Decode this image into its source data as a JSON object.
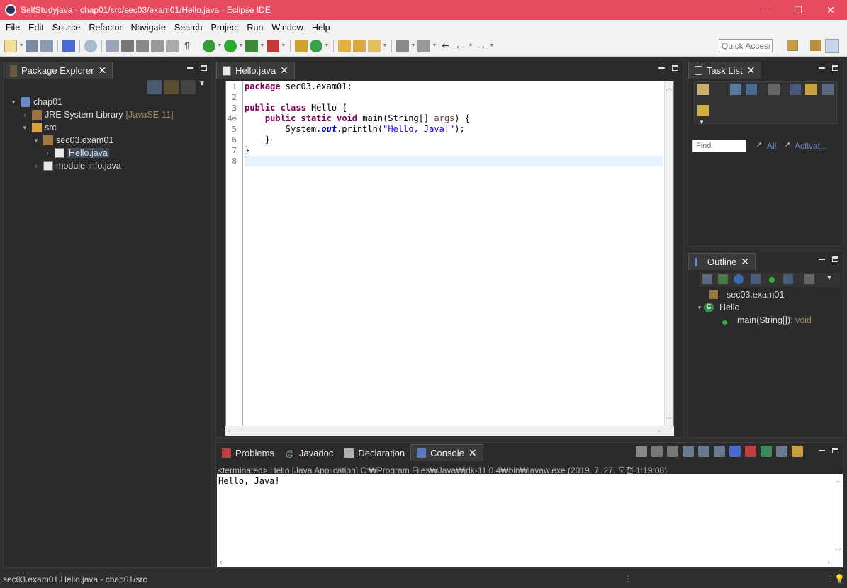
{
  "window": {
    "title": "SelfStudyjava - chap01/src/sec03/exam01/Hello.java - Eclipse IDE",
    "minimize": "—",
    "maximize": "☐",
    "close": "✕"
  },
  "menu": [
    "File",
    "Edit",
    "Source",
    "Refactor",
    "Navigate",
    "Search",
    "Project",
    "Run",
    "Window",
    "Help"
  ],
  "toolbar": {
    "quick_access_placeholder": "Quick Access"
  },
  "package_explorer": {
    "tab_label": "Package Explorer",
    "tree": [
      {
        "label": "chap01",
        "deco": "",
        "indent": 0,
        "twisty": "▾",
        "icon": "project-icon"
      },
      {
        "label": "JRE System Library",
        "deco": "[JavaSE-11]",
        "indent": 1,
        "twisty": "›",
        "icon": "library-icon"
      },
      {
        "label": "src",
        "deco": "",
        "indent": 1,
        "twisty": "▾",
        "icon": "folder-icon"
      },
      {
        "label": "sec03.exam01",
        "deco": "",
        "indent": 2,
        "twisty": "▾",
        "icon": "package-icon"
      },
      {
        "label": "Hello.java",
        "deco": "",
        "indent": 3,
        "twisty": "›",
        "icon": "java-file-icon"
      },
      {
        "label": "module-info.java",
        "deco": "",
        "indent": 2,
        "twisty": "›",
        "icon": "java-file-icon"
      }
    ]
  },
  "editor": {
    "tab_label": "Hello.java",
    "line_numbers": [
      "1",
      "2",
      "3",
      "4⊖",
      "5",
      "6",
      "7",
      "8"
    ],
    "lines": [
      [
        {
          "t": "kw",
          "v": "package"
        },
        {
          "t": "",
          "v": " sec03.exam01;"
        }
      ],
      [],
      [
        {
          "t": "kw",
          "v": "public"
        },
        {
          "t": "",
          "v": " "
        },
        {
          "t": "kw",
          "v": "class"
        },
        {
          "t": "",
          "v": " Hello {"
        }
      ],
      [
        {
          "t": "",
          "v": "    "
        },
        {
          "t": "kw",
          "v": "public"
        },
        {
          "t": "",
          "v": " "
        },
        {
          "t": "kw",
          "v": "static"
        },
        {
          "t": "",
          "v": " "
        },
        {
          "t": "kw",
          "v": "void"
        },
        {
          "t": "",
          "v": " main(String[] "
        },
        {
          "t": "par",
          "v": "args"
        },
        {
          "t": "",
          "v": ") {"
        }
      ],
      [
        {
          "t": "",
          "v": "        System."
        },
        {
          "t": "fld",
          "v": "out"
        },
        {
          "t": "",
          "v": ".println("
        },
        {
          "t": "str",
          "v": "\"Hello, Java!\""
        },
        {
          "t": "",
          "v": ");"
        }
      ],
      [
        {
          "t": "",
          "v": "    }"
        }
      ],
      [
        {
          "t": "",
          "v": "}"
        }
      ],
      []
    ],
    "current_line": 8
  },
  "task_list": {
    "tab_label": "Task List",
    "find_placeholder": "Find",
    "filter_all": "All",
    "filter_activate": "Activat..."
  },
  "outline": {
    "tab_label": "Outline",
    "items": [
      {
        "label": "sec03.exam01",
        "detail": "",
        "indent": 0,
        "icon": "package-icon"
      },
      {
        "label": "Hello",
        "detail": "",
        "indent": 0,
        "icon": "class-icon"
      },
      {
        "label": "main(String[])",
        "detail": " : void",
        "indent": 1,
        "icon": "method-icon"
      }
    ]
  },
  "bottom_tabs": [
    {
      "label": "Problems",
      "icon": "problems-icon",
      "active": false
    },
    {
      "label": "Javadoc",
      "icon": "javadoc-icon",
      "active": false
    },
    {
      "label": "Declaration",
      "icon": "declaration-icon",
      "active": false
    },
    {
      "label": "Console",
      "icon": "console-icon",
      "active": true
    }
  ],
  "console": {
    "status": "<terminated> Hello [Java Application] C:₩Program Files₩Java₩jdk-11.0.4₩bin₩javaw.exe (2019. 7. 27. 오전 1:19:08)",
    "output": "Hello, Java!"
  },
  "statusbar": {
    "text": "sec03.exam01.Hello.java - chap01/src"
  },
  "colors": {
    "titlebar": "#e84a5f",
    "keyword": "#7f0055",
    "string": "#2a00ff",
    "field": "#0000c0"
  }
}
